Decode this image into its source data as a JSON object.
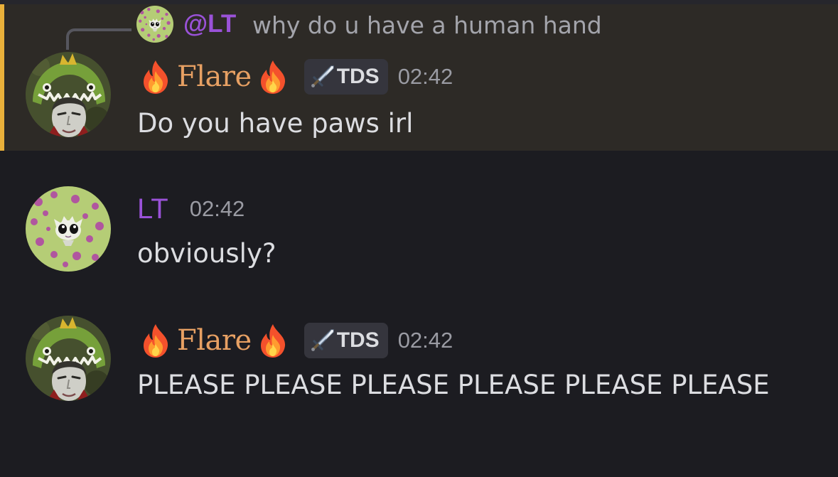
{
  "colors": {
    "background": "#1c1c21",
    "highlight_background": "#2d2a26",
    "highlight_bar": "#e9b03a",
    "flare_name": "#e7a063",
    "lt_name": "#9a52d8",
    "timestamp": "#9a9ba3",
    "tag_background": "#35353d"
  },
  "reply": {
    "mention": "@LT",
    "text": "why do u have a human hand"
  },
  "messages": [
    {
      "author": "Flare",
      "author_prefix_icon": "fire-icon",
      "author_suffix_icon": "fire-icon",
      "tag_icon": "sword-icon",
      "tag": "TDS",
      "time": "02:42",
      "text": "Do you have paws irl"
    },
    {
      "author": "LT",
      "time": "02:42",
      "text": "obviously?"
    },
    {
      "author": "Flare",
      "author_prefix_icon": "fire-icon",
      "author_suffix_icon": "fire-icon",
      "tag_icon": "sword-icon",
      "tag": "TDS",
      "time": "02:42",
      "text": "PLEASE PLEASE PLEASE PLEASE PLEASE PLEASE"
    }
  ]
}
